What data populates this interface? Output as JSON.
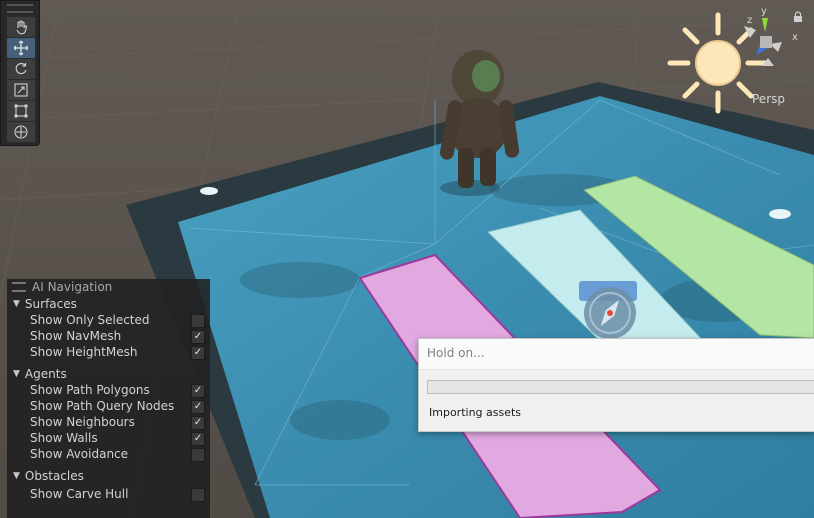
{
  "scene": {
    "view_mode": "Persp",
    "axis_y_label": "y",
    "axis_z_label": "z",
    "axis_x_label": "x"
  },
  "tools": [
    {
      "name": "hand-tool-button",
      "icon": "hand-icon"
    },
    {
      "name": "move-tool-button",
      "icon": "move-icon",
      "active": true
    },
    {
      "name": "rotate-tool-button",
      "icon": "rotate-icon"
    },
    {
      "name": "scale-tool-button",
      "icon": "scale-icon"
    },
    {
      "name": "rect-tool-button",
      "icon": "rect-icon"
    },
    {
      "name": "transform-tool-button",
      "icon": "transform-icon"
    }
  ],
  "ai_navigation": {
    "title": "AI Navigation",
    "surfaces": {
      "label": "Surfaces",
      "show_only_selected": {
        "label": "Show Only Selected",
        "checked": false
      },
      "show_navmesh": {
        "label": "Show NavMesh",
        "checked": true
      },
      "show_heightmesh": {
        "label": "Show HeightMesh",
        "checked": true
      }
    },
    "agents": {
      "label": "Agents",
      "show_path_polygons": {
        "label": "Show Path Polygons",
        "checked": true
      },
      "show_path_query_nodes": {
        "label": "Show Path Query Nodes",
        "checked": true
      },
      "show_neighbours": {
        "label": "Show Neighbours",
        "checked": true
      },
      "show_walls": {
        "label": "Show Walls",
        "checked": true
      },
      "show_avoidance": {
        "label": "Show Avoidance",
        "checked": false
      }
    },
    "obstacles": {
      "label": "Obstacles",
      "show_carve_hull": {
        "label": "Show Carve Hull",
        "checked": false
      }
    }
  },
  "progress_dialog": {
    "title": "Hold on...",
    "status": "Importing assets",
    "progress": 0.0
  },
  "colors": {
    "floor": "#3a8fb0",
    "pink_area": "#e2a8e0",
    "white_area": "#bfe9ec",
    "green_area": "#b3e6a4",
    "navmesh_border": "#9c3a9c"
  }
}
